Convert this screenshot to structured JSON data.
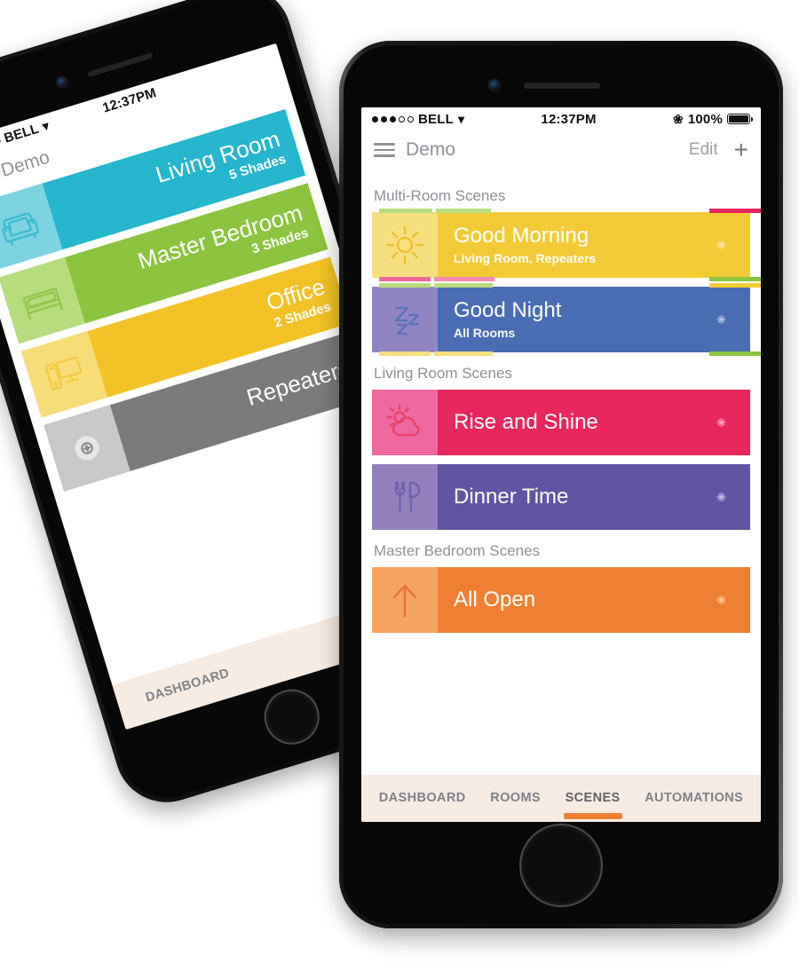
{
  "colors": {
    "accent_orange": "#ef8033",
    "tabbar_bg": "#f7ece3",
    "section_text": "#8c9196",
    "nav_text": "#8e9299",
    "screen_bg": "#ffffff"
  },
  "front_phone": {
    "status_bar": {
      "carrier": "BELL",
      "signal_filled_dots": 3,
      "signal_hollow_dots": 2,
      "wifi_icon": "wifi-icon",
      "time": "12:37PM",
      "bluetooth_icon": "bluetooth-icon",
      "battery_percent": "100%",
      "battery_icon": "battery-full-icon"
    },
    "nav_bar": {
      "menu_icon": "hamburger-menu-icon",
      "title": "Demo",
      "edit_label": "Edit",
      "add_icon": "plus-icon"
    },
    "sections": [
      {
        "header": "Multi-Room Scenes",
        "scenes": [
          {
            "title": "Good Morning",
            "subtitle": "Living Room, Repeaters",
            "icon": "sun-icon",
            "body_color": "#f2ca36",
            "icon_panel_color": "#f5df7f",
            "icon_stroke": "#efc02e",
            "gear_icon": "gear-icon",
            "gear_color": "#f7e08d"
          },
          {
            "title": "Good Night",
            "subtitle": "All Rooms",
            "icon": "zzz-sleep-icon",
            "body_color": "#4a6cb3",
            "icon_panel_color": "#9185c4",
            "icon_stroke": "#5d74bd",
            "gear_icon": "gear-icon",
            "gear_color": "#9db1da"
          }
        ]
      },
      {
        "header": "Living Room Scenes",
        "scenes": [
          {
            "title": "Rise and Shine",
            "subtitle": "",
            "icon": "sun-cloud-icon",
            "body_color": "#e8275e",
            "icon_panel_color": "#ef69a0",
            "icon_stroke": "#e8446f",
            "gear_icon": "gear-icon",
            "gear_color": "#f48ab0"
          },
          {
            "title": "Dinner Time",
            "subtitle": "",
            "icon": "fork-knife-icon",
            "body_color": "#6354a3",
            "icon_panel_color": "#9480bd",
            "icon_stroke": "#6f63ad",
            "gear_icon": "gear-icon",
            "gear_color": "#b2a6d4"
          }
        ]
      },
      {
        "header": "Master Bedroom Scenes",
        "scenes": [
          {
            "title": "All Open",
            "subtitle": "",
            "icon": "arrow-up-icon",
            "body_color": "#ef8033",
            "icon_panel_color": "#f5a košice",
            "icon_stroke": "#e8703a",
            "gear_icon": "gear-icon",
            "gear_color": "#f7bb89"
          }
        ]
      }
    ],
    "tabs": [
      {
        "label": "DASHBOARD",
        "active": false
      },
      {
        "label": "ROOMS",
        "active": false
      },
      {
        "label": "SCENES",
        "active": true
      },
      {
        "label": "AUTOMATIONS",
        "active": false
      }
    ]
  },
  "back_phone": {
    "status_bar": {
      "carrier": "BELL",
      "wifi_icon": "wifi-icon",
      "time": "12:37PM"
    },
    "nav_bar": {
      "menu_icon": "hamburger-menu-icon",
      "title": "Demo"
    },
    "rooms": [
      {
        "title": "Living Room",
        "subtitle": "5 Shades",
        "icon": "sofa-icon",
        "body_color": "#26b6cd",
        "icon_panel_color": "#7dd3e0",
        "icon_stroke": "#3fbdd2"
      },
      {
        "title": "Master Bedroom",
        "subtitle": "3 Shades",
        "icon": "bed-icon",
        "body_color": "#8cc43f",
        "icon_panel_color": "#b7dc7e",
        "icon_stroke": "#95c84f"
      },
      {
        "title": "Office",
        "subtitle": "2 Shades",
        "icon": "computer-icon",
        "body_color": "#f2c226",
        "icon_panel_color": "#f7dd78",
        "icon_stroke": "#f3cb45"
      },
      {
        "title": "Repeaters",
        "subtitle": "",
        "icon": "repeater-icon",
        "body_color": "#7b7b7b",
        "icon_panel_color": "#c8c8c8",
        "icon_stroke": "#e8e8e8"
      }
    ],
    "tabs": [
      {
        "label": "DASHBOARD"
      }
    ]
  }
}
